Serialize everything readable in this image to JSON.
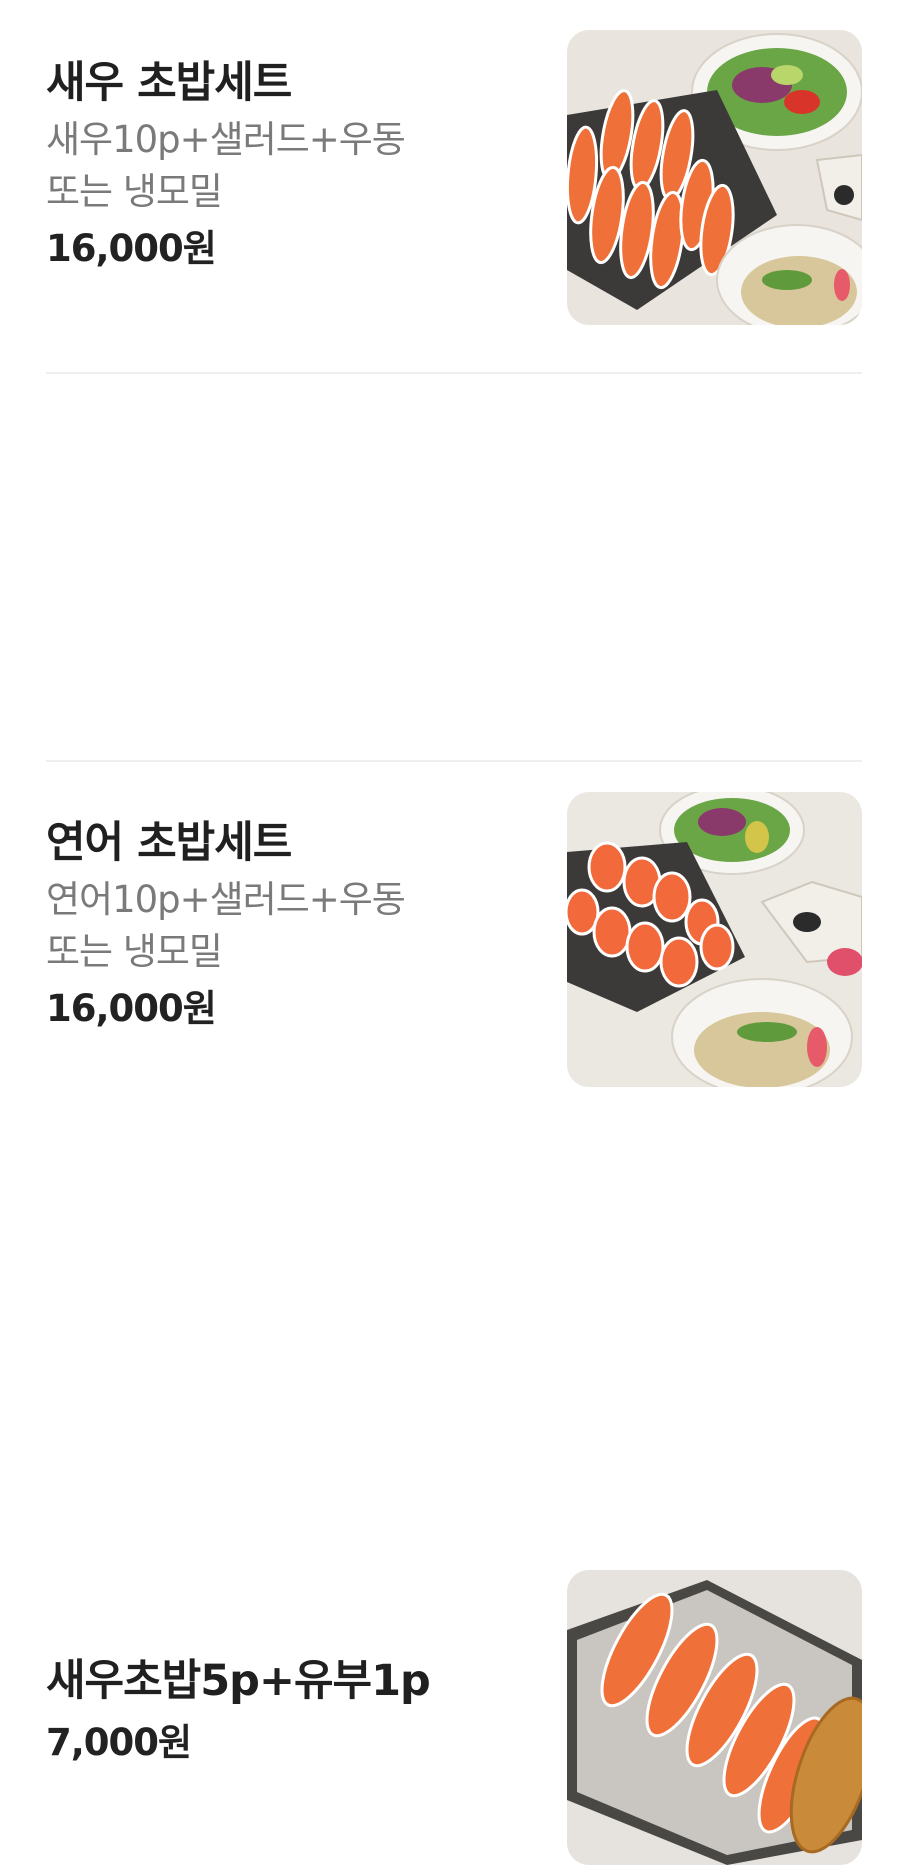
{
  "menu": {
    "items": [
      {
        "name": "새우 초밥세트",
        "description_line1": "새우10p+샐러드+우동",
        "description_line2": "또는 냉모밀",
        "price": "16,000원",
        "image_icon": "shrimp-sushi-set-photo"
      },
      {
        "name": "연어 초밥세트",
        "description_line1": "연어10p+샐러드+우동",
        "description_line2": "또는 냉모밀",
        "price": "16,000원",
        "image_icon": "salmon-sushi-set-photo"
      },
      {
        "name": "새우초밥5p+유부1p",
        "price": "7,000원",
        "image_icon": "shrimp-inari-sushi-photo"
      }
    ]
  },
  "colors": {
    "title": "#202020",
    "description": "#7a7a7a",
    "divider": "#eeeeee",
    "shrimp": "#f0703a",
    "salmon": "#f26a3c"
  }
}
